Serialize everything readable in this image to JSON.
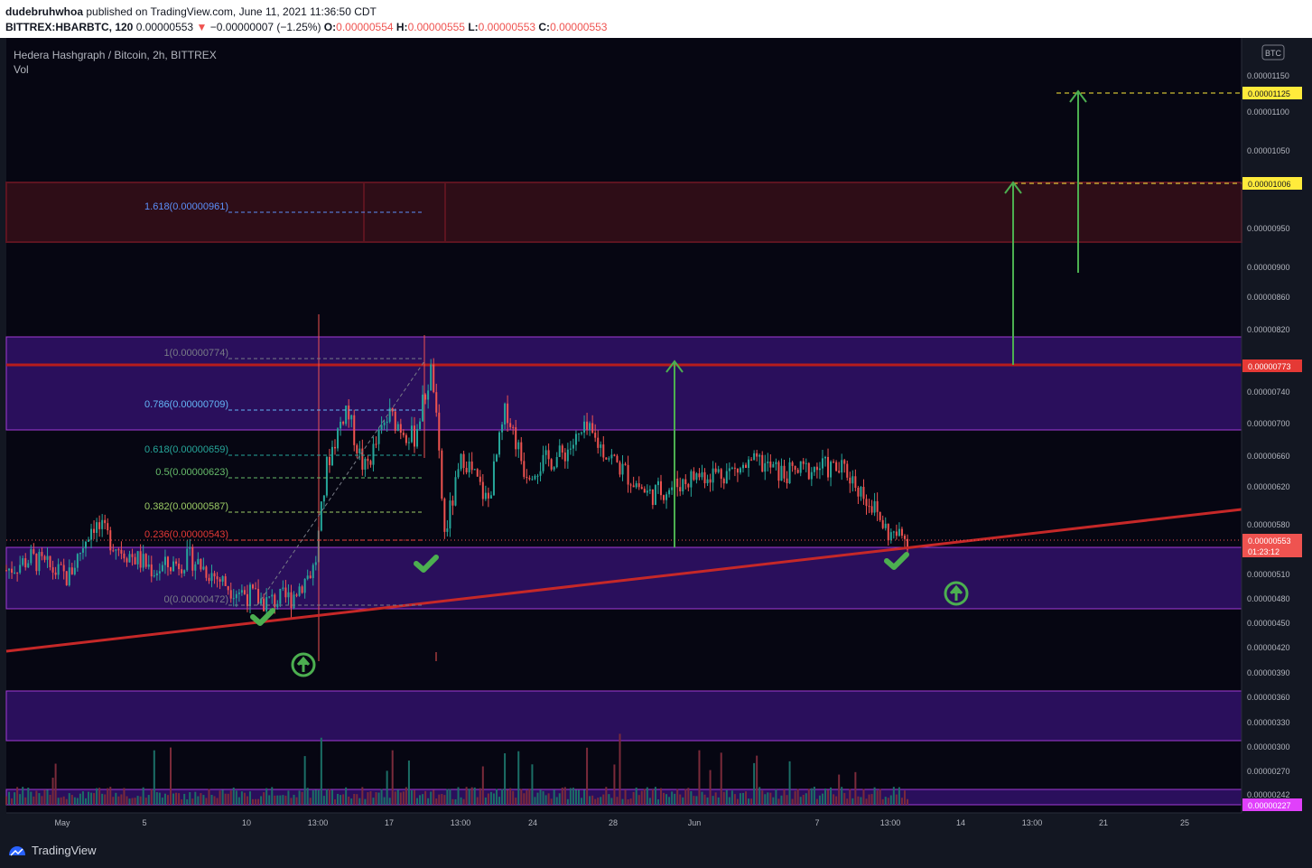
{
  "header": {
    "author": "dudebruhwhoa",
    "published_text": "published on TradingView.com, June 11, 2021 11:36:50 CDT",
    "symbol": "BITTREX:HBARBTC, 120",
    "last": "0.00000553",
    "change_arrow": "▼",
    "change": "−0.00000007 (−1.25%)",
    "o_label": "O:",
    "o": "0.00000554",
    "h_label": "H:",
    "h": "0.00000555",
    "l_label": "L:",
    "l": "0.00000553",
    "c_label": "C:",
    "c": "0.00000553"
  },
  "legend": {
    "title": "Hedera Hashgraph / Bitcoin, 2h, BITTREX",
    "vol": "Vol"
  },
  "scale": {
    "currency_badge": "BTC",
    "ticks": [
      "0.00001150",
      "0.00001100",
      "0.00001050",
      "0.00000950",
      "0.00000900",
      "0.00000860",
      "0.00000820",
      "0.00000740",
      "0.00000700",
      "0.00000660",
      "0.00000620",
      "0.00000580",
      "0.00000510",
      "0.00000480",
      "0.00000450",
      "0.00000420",
      "0.00000390",
      "0.00000360",
      "0.00000330",
      "0.00000300",
      "0.00000270",
      "0.00000242"
    ],
    "labels": {
      "target_high": "0.00001125",
      "target_mid": "0.00001006",
      "resistance": "0.00000773",
      "last_price": "0.00000553",
      "countdown": "01:23:12",
      "volume": "0.00000227"
    },
    "label_colors": {
      "target": "#ffeb3b",
      "resistance": "#e53935",
      "last": "#ef5350",
      "volume": "#e040fb"
    }
  },
  "time_axis": [
    "May",
    "5",
    "10",
    "13:00",
    "17",
    "13:00",
    "24",
    "28",
    "Jun",
    "7",
    "13:00",
    "14",
    "13:00",
    "21",
    "25"
  ],
  "fibonacci": [
    {
      "level": "1.618",
      "price": "0.00000961",
      "color": "#5b8ff9"
    },
    {
      "level": "1",
      "price": "0.00000774",
      "color": "#787b86"
    },
    {
      "level": "0.786",
      "price": "0.00000709",
      "color": "#64b5f6"
    },
    {
      "level": "0.618",
      "price": "0.00000659",
      "color": "#26a69a"
    },
    {
      "level": "0.5",
      "price": "0.00000623",
      "color": "#66bb6a"
    },
    {
      "level": "0.382",
      "price": "0.00000587",
      "color": "#9ccc65"
    },
    {
      "level": "0.236",
      "price": "0.00000543",
      "color": "#e53935"
    },
    {
      "level": "0",
      "price": "0.00000472",
      "color": "#787b86"
    }
  ],
  "colors": {
    "background": "#131722",
    "zone_purple": "#3b0a73",
    "zone_red": "#4a0f16",
    "trendline": "#c62828",
    "up_candle": "#26a69a",
    "down_candle": "#ef5350",
    "arrow": "#4caf50"
  },
  "footer": {
    "brand": "TradingView"
  },
  "chart_data": {
    "type": "candlestick",
    "series_name": "Hedera Hashgraph / Bitcoin, 2h, BITTREX",
    "y_range": [
      2.27e-06,
      1.15e-05
    ],
    "price_path": [
      [
        0,
        5.15e-06
      ],
      [
        0.02,
        5.3e-06
      ],
      [
        0.05,
        5.05e-06
      ],
      [
        0.07,
        5.75e-06
      ],
      [
        0.09,
        5.45e-06
      ],
      [
        0.12,
        5.15e-06
      ],
      [
        0.15,
        5.3e-06
      ],
      [
        0.18,
        4.95e-06
      ],
      [
        0.21,
        4.75e-06
      ],
      [
        0.23,
        4.8e-06
      ],
      [
        0.25,
        5.2e-06
      ],
      [
        0.26,
        6.5e-06
      ],
      [
        0.275,
        7.2e-06
      ],
      [
        0.29,
        6.4e-06
      ],
      [
        0.31,
        7.1e-06
      ],
      [
        0.33,
        6.8e-06
      ],
      [
        0.345,
        7.7e-06
      ],
      [
        0.355,
        5.6e-06
      ],
      [
        0.37,
        6.6e-06
      ],
      [
        0.39,
        6e-06
      ],
      [
        0.405,
        7.2e-06
      ],
      [
        0.42,
        6.4e-06
      ],
      [
        0.45,
        6.6e-06
      ],
      [
        0.47,
        6.9e-06
      ],
      [
        0.5,
        6.4e-06
      ],
      [
        0.52,
        6.1e-06
      ],
      [
        0.54,
        6.2e-06
      ],
      [
        0.56,
        6.35e-06
      ],
      [
        0.59,
        6.4e-06
      ],
      [
        0.61,
        6.5e-06
      ],
      [
        0.63,
        6.35e-06
      ],
      [
        0.66,
        6.45e-06
      ],
      [
        0.68,
        6.4e-06
      ],
      [
        0.7,
        6e-06
      ],
      [
        0.715,
        5.6e-06
      ],
      [
        0.73,
        5.55e-06
      ]
    ],
    "annotations": [
      "check marks at three trendline touches",
      "green up-arrow circles",
      "long arrows to 0.00000773, 0.00001006, 0.00001125"
    ]
  }
}
